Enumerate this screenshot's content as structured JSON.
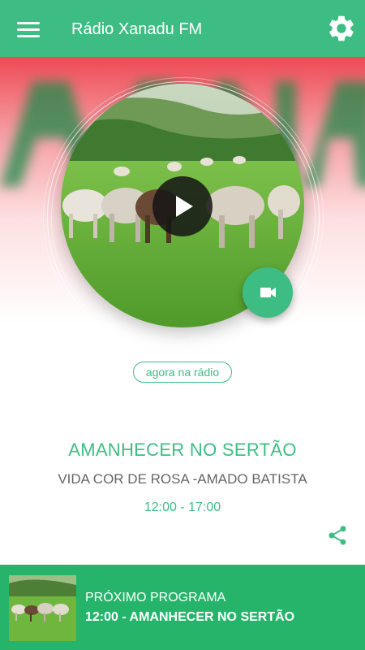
{
  "app": {
    "title": "Rádio Xanadu FM",
    "accent_color": "#3dbd83",
    "menu_icon": "hamburger-menu-icon",
    "settings_icon": "gear-icon"
  },
  "player": {
    "cover_image": "cattle-in-green-pasture",
    "play_icon": "play-icon",
    "video_icon": "video-camera-icon",
    "now_badge": "agora na rádio"
  },
  "program": {
    "title": "AMANHECER NO SERTÃO",
    "song": "VIDA COR DE ROSA -AMADO BATISTA",
    "time": "12:00 - 17:00",
    "share_icon": "share-icon"
  },
  "next": {
    "label": "PRÓXIMO PROGRAMA",
    "title": "12:00 - AMANHECER NO SERTÃO",
    "bar_color": "#26b46b",
    "thumbnail": "cattle-in-green-pasture"
  }
}
